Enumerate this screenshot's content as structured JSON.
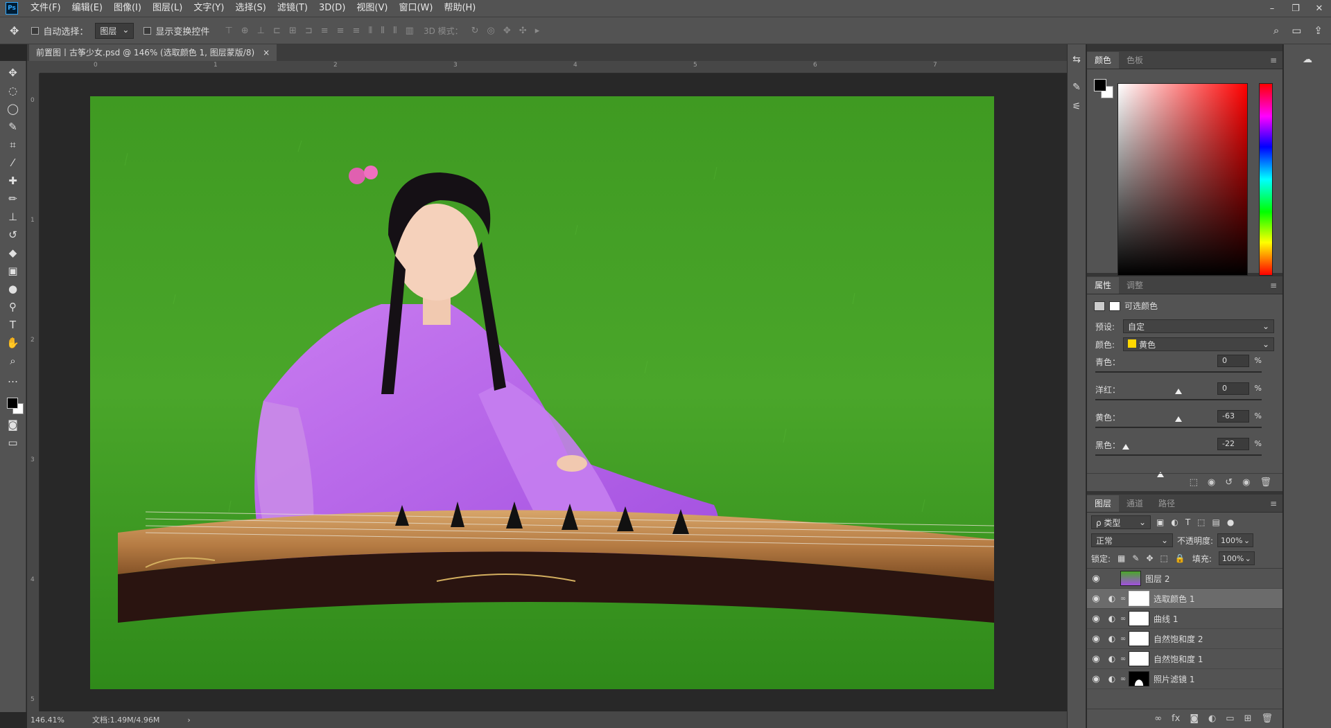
{
  "app": {
    "logo": "Ps"
  },
  "menu": [
    "文件(F)",
    "编辑(E)",
    "图像(I)",
    "图层(L)",
    "文字(Y)",
    "选择(S)",
    "滤镜(T)",
    "3D(D)",
    "视图(V)",
    "窗口(W)",
    "帮助(H)"
  ],
  "window_controls": {
    "minimize": "–",
    "restore": "❐",
    "close": "✕"
  },
  "options": {
    "auto_select_label": "自动选择：",
    "auto_select_target": "图层",
    "show_transform_label": "显示变换控件",
    "mode_3d_label": "3D 模式："
  },
  "document_tab": {
    "title": "前置图丨古筝少女.psd @ 146% (选取颜色 1, 图层蒙版/8)",
    "close": "×"
  },
  "ruler_h_ticks": [
    "0",
    "1",
    "2",
    "3",
    "4",
    "5",
    "6",
    "7"
  ],
  "ruler_v_ticks": [
    "0",
    "1",
    "2",
    "3",
    "4",
    "5"
  ],
  "status": {
    "zoom": "146.41%",
    "doc_info": "文档:1.49M/4.96M",
    "arrow": "›"
  },
  "color_panel": {
    "tabs": [
      "颜色",
      "色板"
    ],
    "active_tab": 0,
    "menu": "≡"
  },
  "properties_panel": {
    "tabs": [
      "属性",
      "调整"
    ],
    "active_tab": 0,
    "adjustment_name": "可选颜色",
    "preset_label": "预设:",
    "preset_value": "自定",
    "colors_label": "颜色:",
    "colors_value": "黄色",
    "colors_swatch": "#ffd800",
    "sliders": [
      {
        "label": "青色：",
        "value": "0",
        "pct": "%",
        "level": 0
      },
      {
        "label": "洋红：",
        "value": "0",
        "pct": "%",
        "level": 0
      },
      {
        "label": "黄色：",
        "value": "-63",
        "pct": "%",
        "level": -63
      },
      {
        "label": "黑色：",
        "value": "-22",
        "pct": "%",
        "level": -22
      }
    ]
  },
  "layers_panel": {
    "tabs": [
      "图层",
      "通道",
      "路径"
    ],
    "active_tab": 0,
    "filter_label": "ρ 类型",
    "blend_mode": "正常",
    "opacity_label": "不透明度:",
    "opacity_value": "100%",
    "lock_label": "锁定:",
    "fill_label": "填充:",
    "fill_value": "100%",
    "layers": [
      {
        "name": "图层 2",
        "selected": false,
        "type": "pixel"
      },
      {
        "name": "选取颜色 1",
        "selected": true,
        "type": "adjustment"
      },
      {
        "name": "曲线 1",
        "selected": false,
        "type": "adjustment"
      },
      {
        "name": "自然饱和度 2",
        "selected": false,
        "type": "adjustment"
      },
      {
        "name": "自然饱和度 1",
        "selected": false,
        "type": "adjustment"
      },
      {
        "name": "照片滤镜 1",
        "selected": false,
        "type": "adjustment-dark-mask"
      }
    ]
  }
}
